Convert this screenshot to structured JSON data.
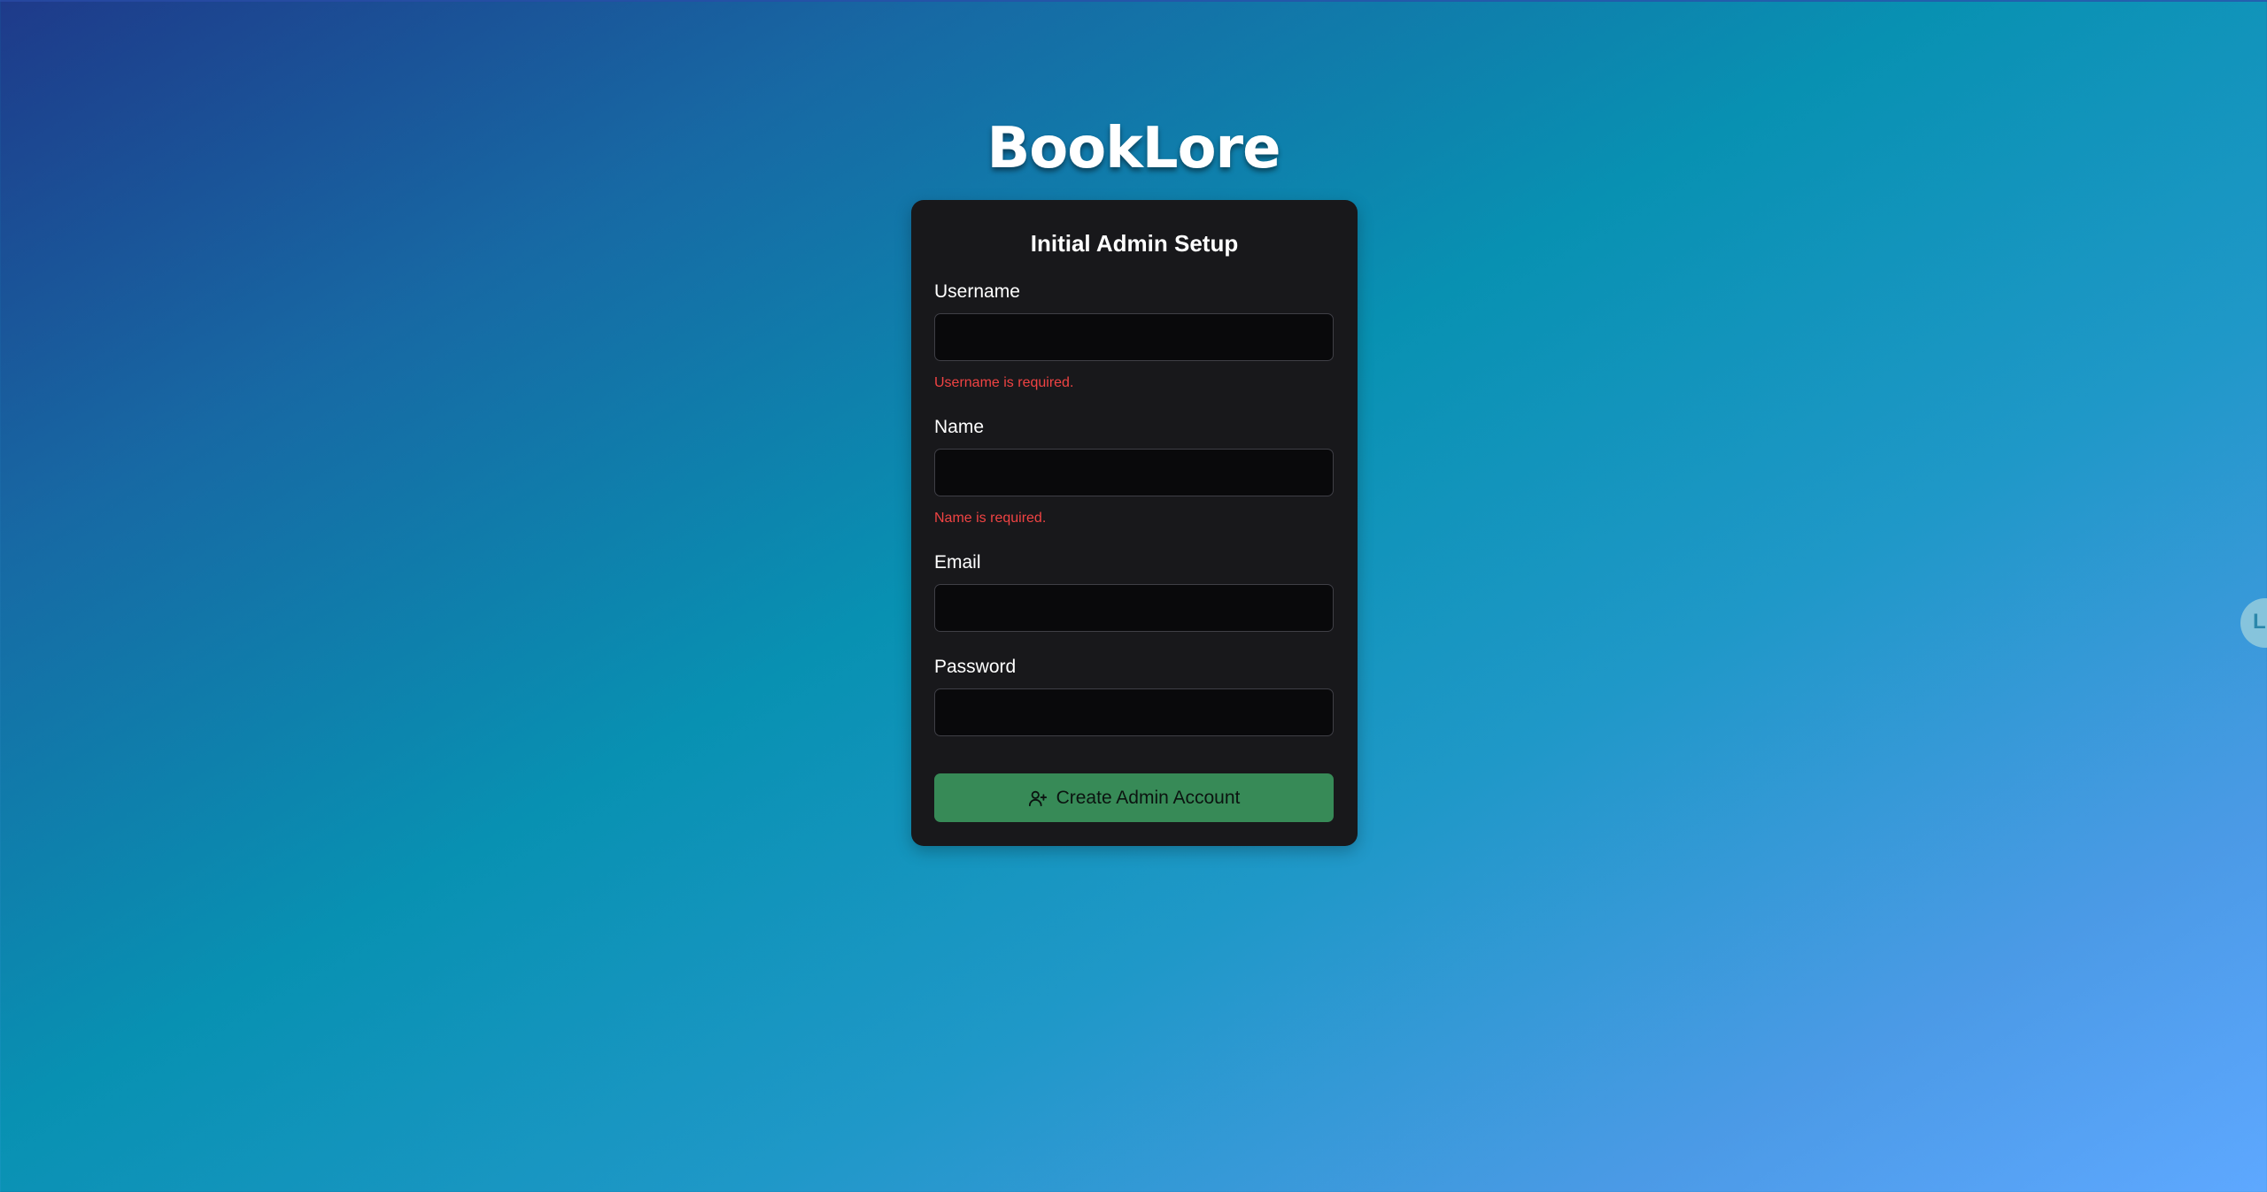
{
  "app": {
    "brand": "BookLore"
  },
  "form": {
    "title": "Initial Admin Setup",
    "fields": {
      "username": {
        "label": "Username",
        "value": "",
        "error": "Username is required."
      },
      "name": {
        "label": "Name",
        "value": "",
        "error": "Name is required."
      },
      "email": {
        "label": "Email",
        "value": ""
      },
      "password": {
        "label": "Password",
        "value": ""
      }
    },
    "submit": {
      "label": "Create Admin Account",
      "icon": "user-plus-icon"
    }
  },
  "colors": {
    "background_start": "#1e3a8a",
    "background_mid": "#0891b2",
    "background_end": "#5ea8ff",
    "card": "#18181b",
    "input": "#09090b",
    "error": "#f04343",
    "submit": "#378a57"
  },
  "floating_widget": {
    "icon": "floating-chat-icon"
  }
}
